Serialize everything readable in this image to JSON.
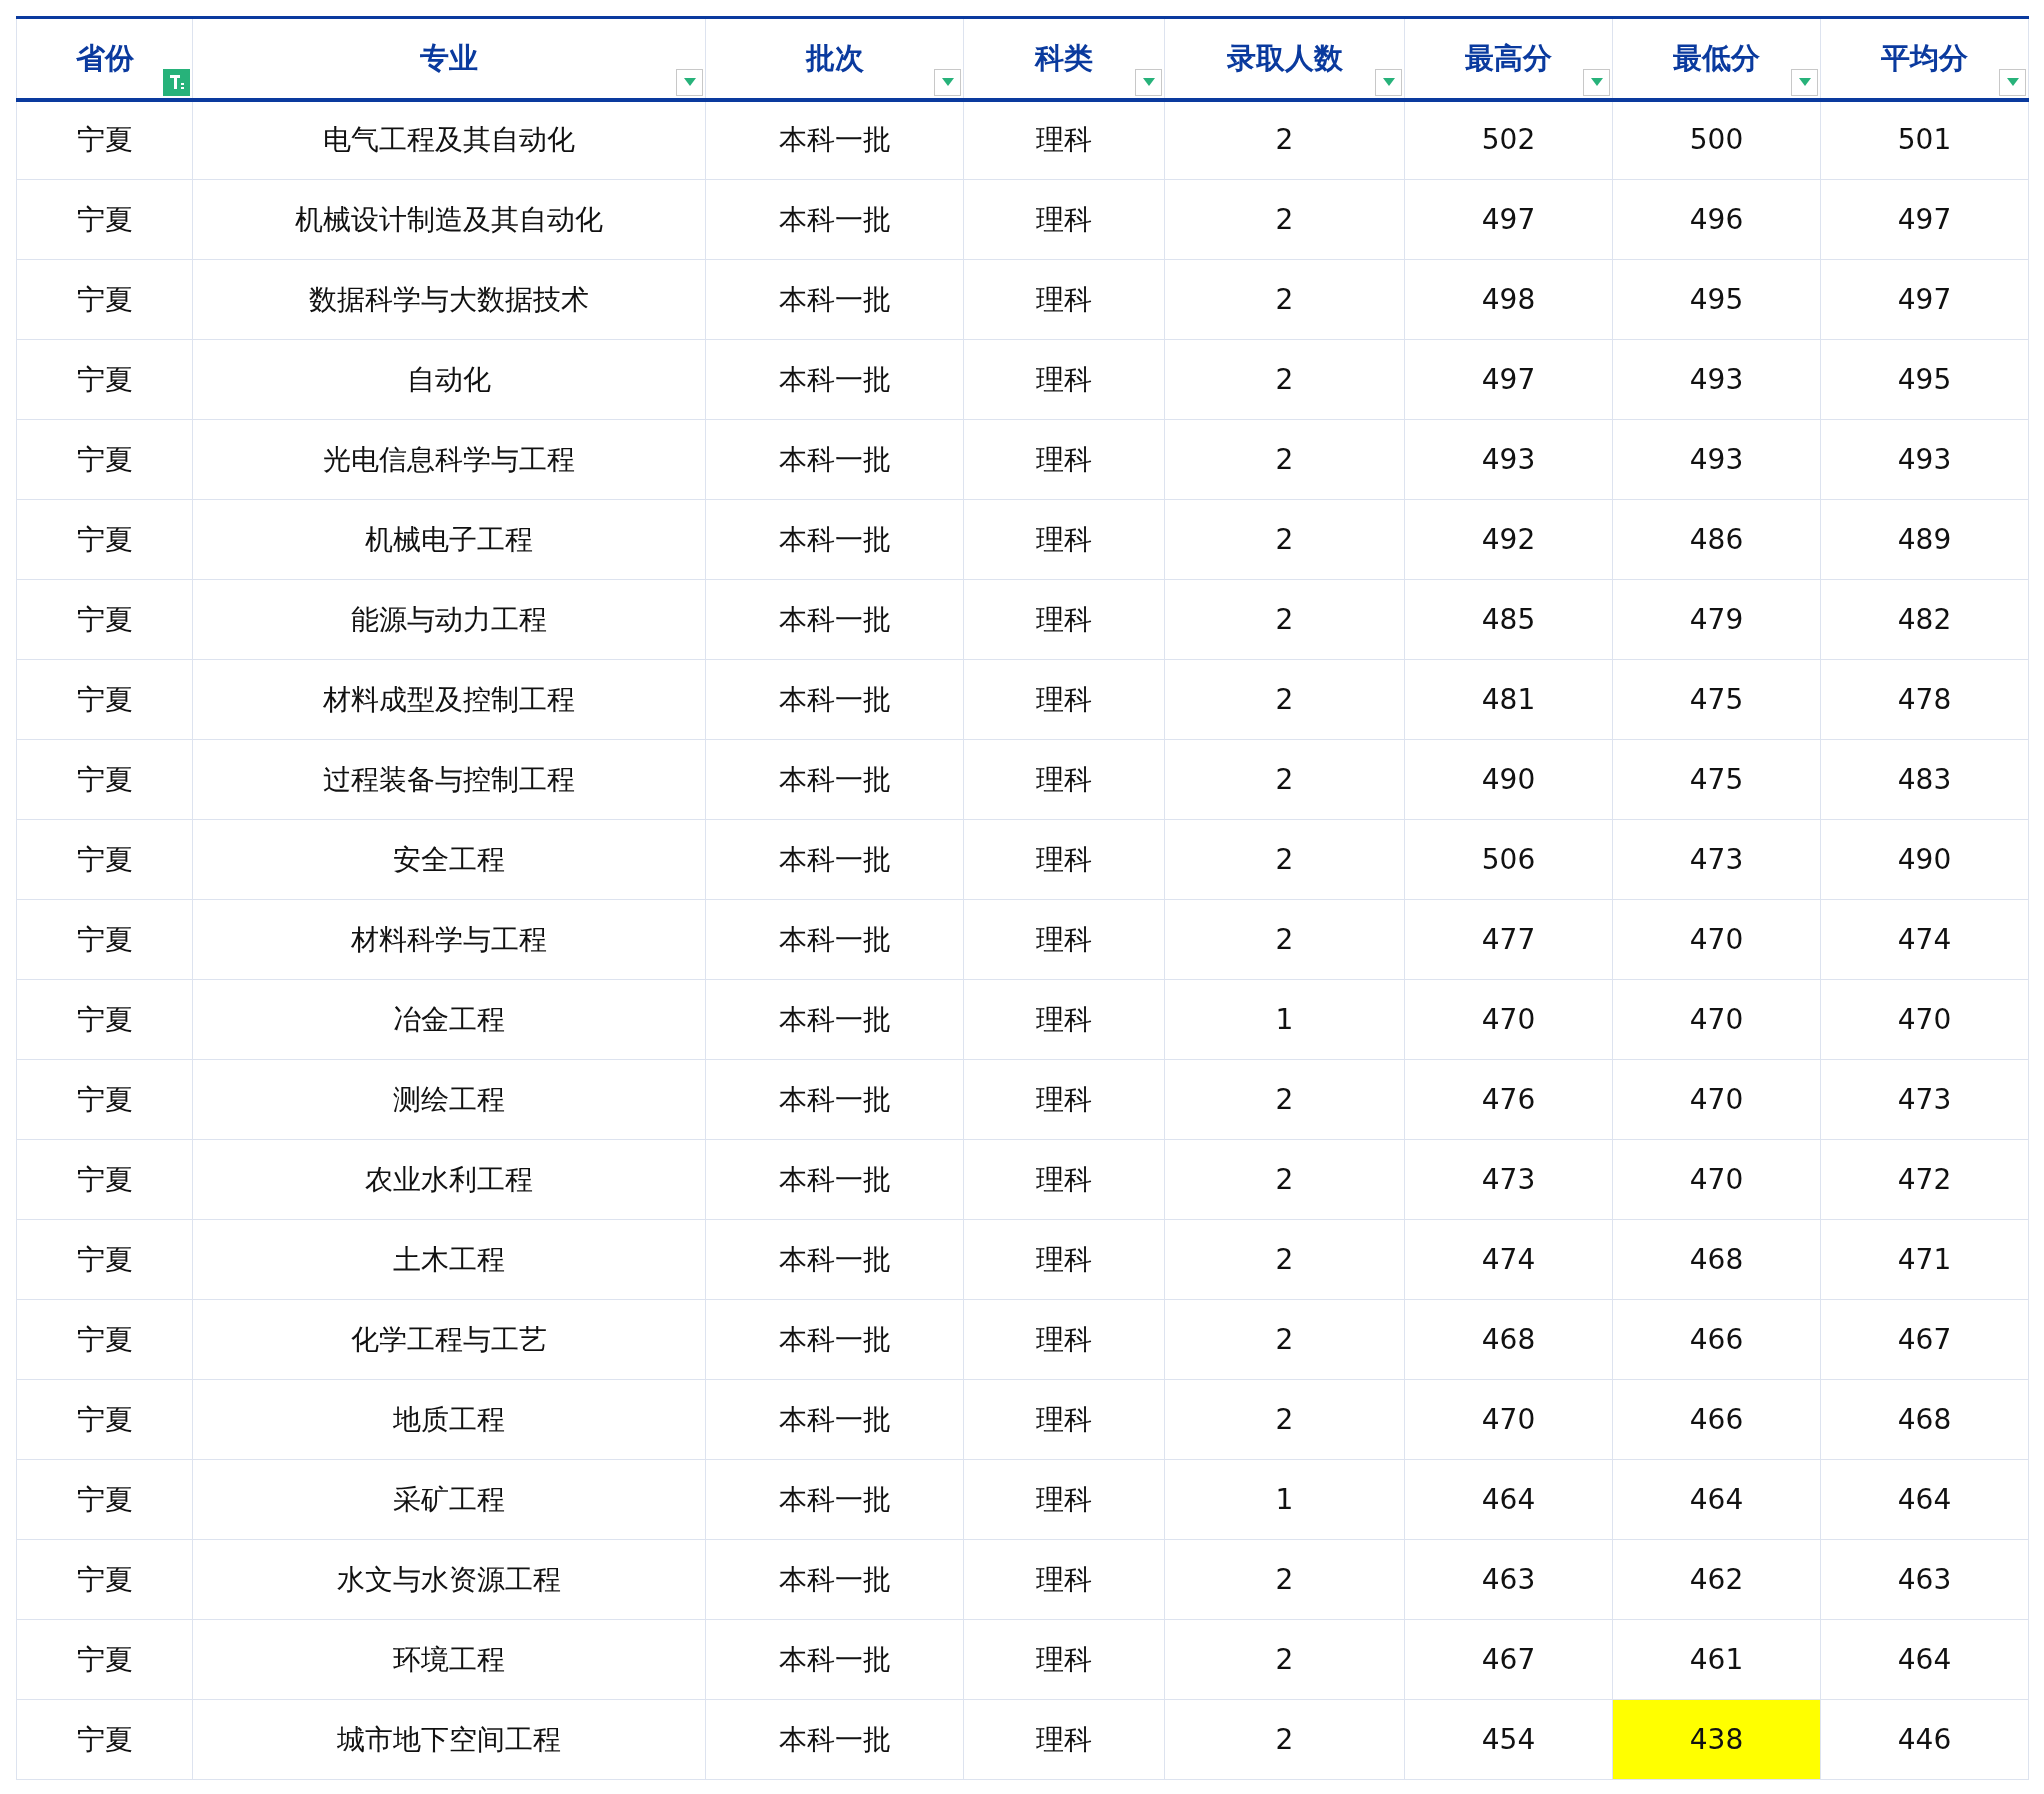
{
  "table": {
    "columns": [
      {
        "label": "省份",
        "filter_active": true
      },
      {
        "label": "专业",
        "filter_active": false
      },
      {
        "label": "批次",
        "filter_active": false
      },
      {
        "label": "科类",
        "filter_active": false
      },
      {
        "label": "录取人数",
        "filter_active": false
      },
      {
        "label": "最高分",
        "filter_active": false
      },
      {
        "label": "最低分",
        "filter_active": false
      },
      {
        "label": "平均分",
        "filter_active": false
      }
    ],
    "rows": [
      [
        "宁夏",
        "电气工程及其自动化",
        "本科一批",
        "理科",
        "2",
        "502",
        "500",
        "501"
      ],
      [
        "宁夏",
        "机械设计制造及其自动化",
        "本科一批",
        "理科",
        "2",
        "497",
        "496",
        "497"
      ],
      [
        "宁夏",
        "数据科学与大数据技术",
        "本科一批",
        "理科",
        "2",
        "498",
        "495",
        "497"
      ],
      [
        "宁夏",
        "自动化",
        "本科一批",
        "理科",
        "2",
        "497",
        "493",
        "495"
      ],
      [
        "宁夏",
        "光电信息科学与工程",
        "本科一批",
        "理科",
        "2",
        "493",
        "493",
        "493"
      ],
      [
        "宁夏",
        "机械电子工程",
        "本科一批",
        "理科",
        "2",
        "492",
        "486",
        "489"
      ],
      [
        "宁夏",
        "能源与动力工程",
        "本科一批",
        "理科",
        "2",
        "485",
        "479",
        "482"
      ],
      [
        "宁夏",
        "材料成型及控制工程",
        "本科一批",
        "理科",
        "2",
        "481",
        "475",
        "478"
      ],
      [
        "宁夏",
        "过程装备与控制工程",
        "本科一批",
        "理科",
        "2",
        "490",
        "475",
        "483"
      ],
      [
        "宁夏",
        "安全工程",
        "本科一批",
        "理科",
        "2",
        "506",
        "473",
        "490"
      ],
      [
        "宁夏",
        "材料科学与工程",
        "本科一批",
        "理科",
        "2",
        "477",
        "470",
        "474"
      ],
      [
        "宁夏",
        "冶金工程",
        "本科一批",
        "理科",
        "1",
        "470",
        "470",
        "470"
      ],
      [
        "宁夏",
        "测绘工程",
        "本科一批",
        "理科",
        "2",
        "476",
        "470",
        "473"
      ],
      [
        "宁夏",
        "农业水利工程",
        "本科一批",
        "理科",
        "2",
        "473",
        "470",
        "472"
      ],
      [
        "宁夏",
        "土木工程",
        "本科一批",
        "理科",
        "2",
        "474",
        "468",
        "471"
      ],
      [
        "宁夏",
        "化学工程与工艺",
        "本科一批",
        "理科",
        "2",
        "468",
        "466",
        "467"
      ],
      [
        "宁夏",
        "地质工程",
        "本科一批",
        "理科",
        "2",
        "470",
        "466",
        "468"
      ],
      [
        "宁夏",
        "采矿工程",
        "本科一批",
        "理科",
        "1",
        "464",
        "464",
        "464"
      ],
      [
        "宁夏",
        "水文与水资源工程",
        "本科一批",
        "理科",
        "2",
        "463",
        "462",
        "463"
      ],
      [
        "宁夏",
        "环境工程",
        "本科一批",
        "理科",
        "2",
        "467",
        "461",
        "464"
      ],
      [
        "宁夏",
        "城市地下空间工程",
        "本科一批",
        "理科",
        "2",
        "454",
        {
          "text": "438",
          "color": "#ffff00"
        },
        "446"
      ]
    ]
  }
}
